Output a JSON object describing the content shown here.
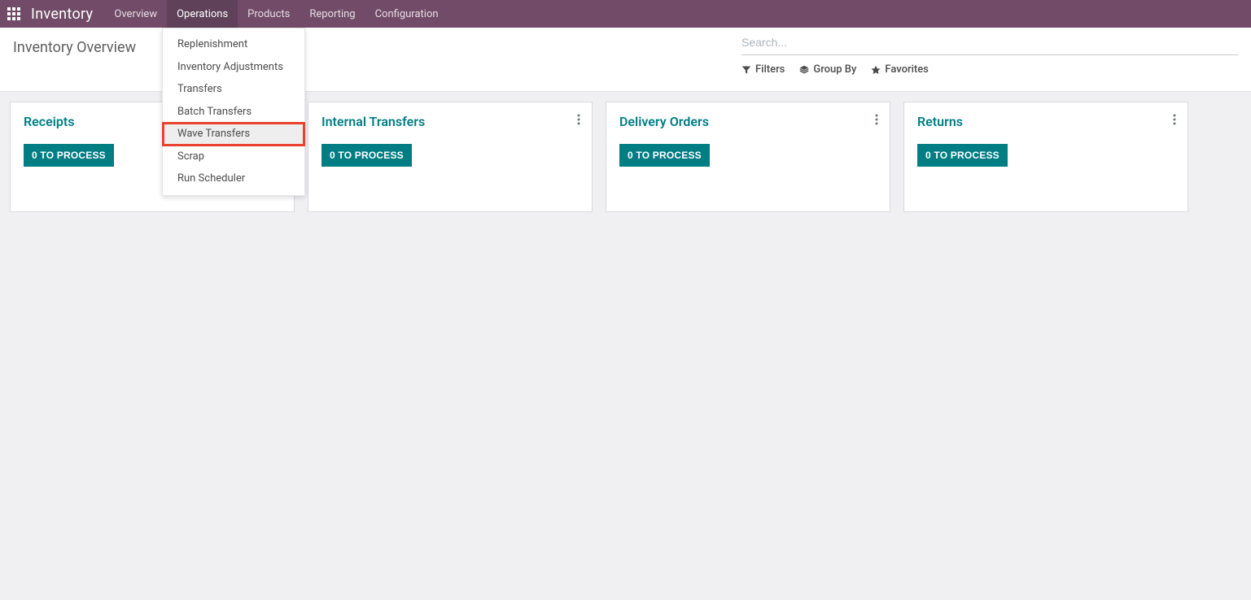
{
  "topbar": {
    "brand": "Inventory",
    "nav": [
      {
        "label": "Overview"
      },
      {
        "label": "Operations"
      },
      {
        "label": "Products"
      },
      {
        "label": "Reporting"
      },
      {
        "label": "Configuration"
      }
    ]
  },
  "page_title": "Inventory Overview",
  "search": {
    "placeholder": "Search...",
    "filters_label": "Filters",
    "groupby_label": "Group By",
    "favorites_label": "Favorites"
  },
  "dropdown": {
    "items": [
      {
        "label": "Replenishment"
      },
      {
        "label": "Inventory Adjustments"
      },
      {
        "label": "Transfers"
      },
      {
        "label": "Batch Transfers"
      },
      {
        "label": "Wave Transfers"
      },
      {
        "label": "Scrap"
      },
      {
        "label": "Run Scheduler"
      }
    ]
  },
  "cards": [
    {
      "title": "Receipts",
      "button": "0 TO PROCESS"
    },
    {
      "title": "Internal Transfers",
      "button": "0 TO PROCESS"
    },
    {
      "title": "Delivery Orders",
      "button": "0 TO PROCESS"
    },
    {
      "title": "Returns",
      "button": "0 TO PROCESS"
    }
  ]
}
